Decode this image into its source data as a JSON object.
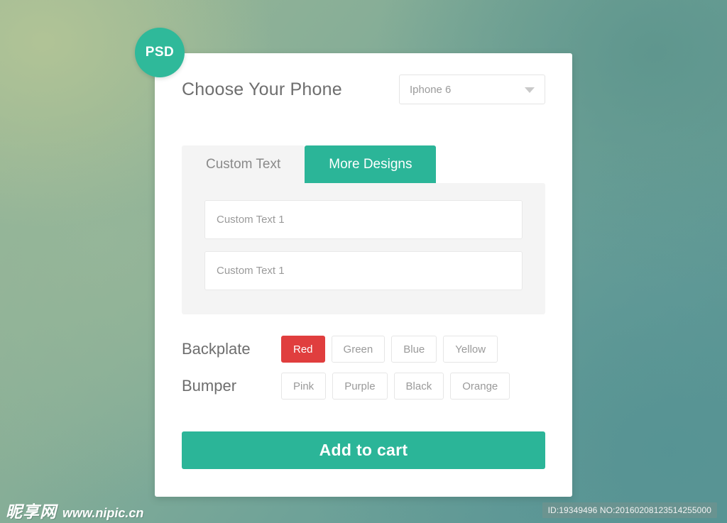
{
  "badge": {
    "label": "PSD"
  },
  "header": {
    "title": "Choose Your Phone",
    "phone_select": {
      "value": "Iphone 6",
      "caret_icon": "chevron-down-icon"
    }
  },
  "tabs": [
    {
      "label": "Custom Text",
      "active": false
    },
    {
      "label": "More Designs",
      "active": true
    }
  ],
  "custom_text_panel": {
    "inputs": [
      {
        "value": "",
        "placeholder": "Custom Text 1"
      },
      {
        "value": "",
        "placeholder": "Custom Text 1"
      }
    ]
  },
  "options": [
    {
      "label": "Backplate",
      "choices": [
        {
          "label": "Red",
          "selected": true
        },
        {
          "label": "Green",
          "selected": false
        },
        {
          "label": "Blue",
          "selected": false
        },
        {
          "label": "Yellow",
          "selected": false
        }
      ]
    },
    {
      "label": "Bumper",
      "choices": [
        {
          "label": "Pink",
          "selected": false
        },
        {
          "label": "Purple",
          "selected": false
        },
        {
          "label": "Black",
          "selected": false
        },
        {
          "label": "Orange",
          "selected": false
        }
      ]
    }
  ],
  "add_to_cart": {
    "label": "Add to cart"
  },
  "watermark": {
    "logo_text": "昵享网",
    "url": "www.nipic.cn",
    "id_text": "ID:19349496 NO:20160208123514255000"
  },
  "colors": {
    "accent_green": "#2bb598",
    "badge_green": "#2fb99a",
    "selected_red": "#e03e3e",
    "panel_gray": "#f4f4f4",
    "text_gray": "#6e6e6e",
    "muted_gray": "#9a9a9a",
    "card_white": "#ffffff",
    "bg_top_left": "#9cb896",
    "bg_bottom_right": "#5c9695"
  }
}
